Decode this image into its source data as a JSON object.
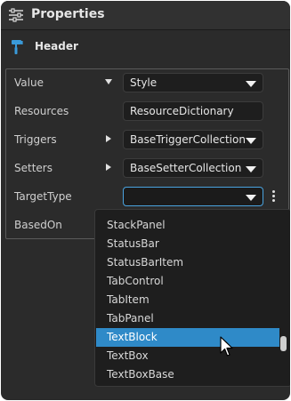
{
  "window": {
    "title": "Properties"
  },
  "section": {
    "header": "Header"
  },
  "properties": [
    {
      "label": "Value",
      "value": "Style"
    },
    {
      "label": "Resources",
      "value": "ResourceDictionary"
    },
    {
      "label": "Triggers",
      "value": "BaseTriggerCollection"
    },
    {
      "label": "Setters",
      "value": "BaseSetterCollection"
    },
    {
      "label": "TargetType",
      "value": ""
    },
    {
      "label": "BasedOn",
      "value": ""
    }
  ],
  "dropdown": {
    "items": [
      "StackPanel",
      "StatusBar",
      "StatusBarItem",
      "TabControl",
      "TabItem",
      "TabPanel",
      "TextBlock",
      "TextBox",
      "TextBoxBase"
    ],
    "selected": "TextBlock"
  },
  "colors": {
    "background": "#2b2b2b",
    "accent": "#2f8ac8",
    "focus_border": "#4aa3df"
  },
  "icons": {
    "title": "properties-sliders-icon",
    "header": "paint-roller-icon",
    "more": "more-vertical-icon",
    "cursor": "mouse-pointer-icon"
  }
}
